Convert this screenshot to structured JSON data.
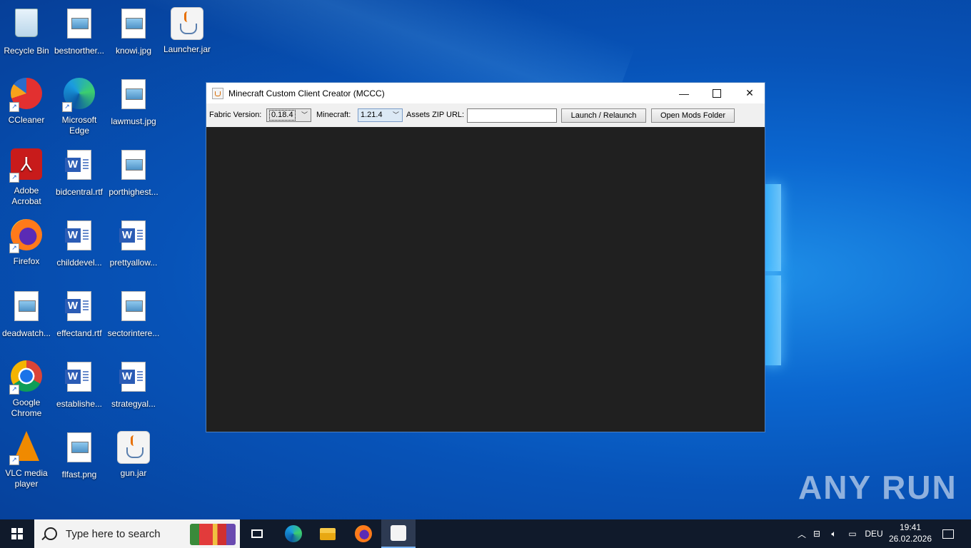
{
  "desktop": {
    "icons": [
      {
        "label": "Recycle Bin"
      },
      {
        "label": "bestnorther..."
      },
      {
        "label": "knowi.jpg"
      },
      {
        "label": "Launcher.jar"
      },
      {
        "label": "CCleaner"
      },
      {
        "label": "Microsoft Edge"
      },
      {
        "label": "lawmust.jpg"
      },
      {
        "label": "Adobe Acrobat"
      },
      {
        "label": "bidcentral.rtf"
      },
      {
        "label": "porthighest..."
      },
      {
        "label": "Firefox"
      },
      {
        "label": "childdevel..."
      },
      {
        "label": "prettyallow..."
      },
      {
        "label": "deadwatch..."
      },
      {
        "label": "effectand.rtf"
      },
      {
        "label": "sectorintere..."
      },
      {
        "label": "Google Chrome"
      },
      {
        "label": "establishe..."
      },
      {
        "label": "strategyal..."
      },
      {
        "label": "VLC media player"
      },
      {
        "label": "flfast.png"
      },
      {
        "label": "gun.jar"
      }
    ],
    "watermark": "ANY RUN"
  },
  "window": {
    "title": "Minecraft Custom Client Creator (MCCC)",
    "controls": {
      "minimize": "—",
      "close": "✕"
    },
    "toolbar": {
      "fabric_label": "Fabric Version:",
      "fabric_value": "0.18.4",
      "minecraft_label": "Minecraft:",
      "minecraft_value": "1.21.4",
      "assets_label": "Assets ZIP URL:",
      "assets_value": "",
      "launch_button": "Launch / Relaunch",
      "mods_button": "Open Mods Folder"
    }
  },
  "taskbar": {
    "search_placeholder": "Type here to search",
    "language": "DEU",
    "time": "19:41",
    "date": "26.02.2026"
  },
  "colors": {
    "desktop_blue": "#0b67d0",
    "taskbar": "#101a2b",
    "console_bg": "#202020"
  }
}
